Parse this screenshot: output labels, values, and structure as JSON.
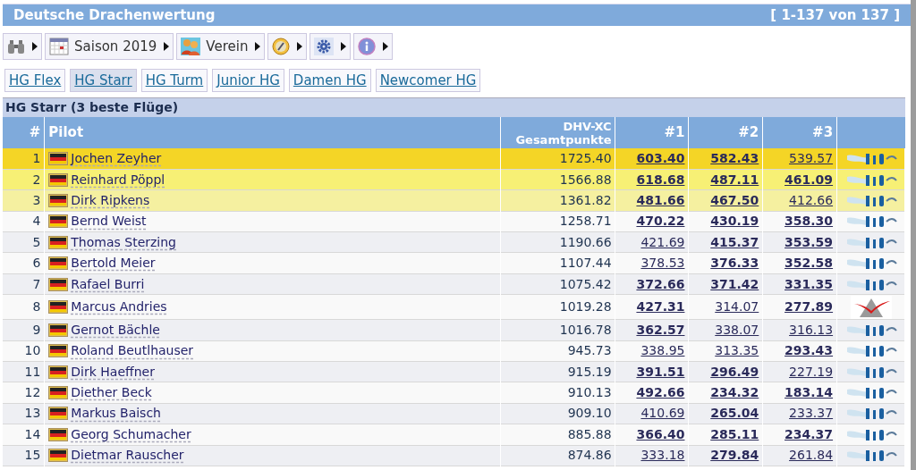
{
  "title": "Deutsche Drachenwertung",
  "range": "[ 1-137 von 137 ]",
  "toolbar": [
    {
      "kind": "binoculars"
    },
    {
      "kind": "calendar",
      "label": "Saison 2019"
    },
    {
      "kind": "people",
      "label": "Verein"
    },
    {
      "kind": "compass"
    },
    {
      "kind": "gear"
    },
    {
      "kind": "info"
    }
  ],
  "tabs": [
    {
      "label": "HG Flex",
      "selected": false
    },
    {
      "label": "HG Starr",
      "selected": true
    },
    {
      "label": "HG Turm",
      "selected": false
    },
    {
      "label": "Junior HG",
      "selected": false
    },
    {
      "label": "Damen HG",
      "selected": false
    },
    {
      "label": "Newcomer HG",
      "selected": false
    }
  ],
  "section_title": "HG Starr (3 beste Flüge)",
  "columns": [
    "#",
    "Pilot",
    "DHV-XC Gesamtpunkte",
    "#1",
    "#2",
    "#3"
  ],
  "rows": [
    {
      "rank": "1",
      "pilot": "Jochen Zeyher",
      "total": "1725.40",
      "flights": [
        {
          "score": "603.40",
          "bold": true
        },
        {
          "score": "582.43",
          "bold": true
        },
        {
          "score": "539.57",
          "bold": false
        }
      ],
      "logo": {
        "kind": "air"
      },
      "color": "#f4d526"
    },
    {
      "rank": "2",
      "pilot": "Reinhard Pöppl",
      "total": "1566.88",
      "flights": [
        {
          "score": "618.68",
          "bold": true
        },
        {
          "score": "487.11",
          "bold": true
        },
        {
          "score": "461.09",
          "bold": true
        }
      ],
      "logo": {
        "kind": "air"
      },
      "color": "#f7f075"
    },
    {
      "rank": "3",
      "pilot": "Dirk Ripkens",
      "total": "1361.82",
      "flights": [
        {
          "score": "481.66",
          "bold": true
        },
        {
          "score": "467.50",
          "bold": true
        },
        {
          "score": "412.66",
          "bold": false
        }
      ],
      "logo": {
        "kind": "air"
      },
      "color": "#f5f0a0"
    },
    {
      "rank": "4",
      "pilot": "Bernd Weist",
      "total": "1258.71",
      "flights": [
        {
          "score": "470.22",
          "bold": true
        },
        {
          "score": "430.19",
          "bold": true
        },
        {
          "score": "358.30",
          "bold": true
        }
      ],
      "logo": {
        "kind": "air"
      }
    },
    {
      "rank": "5",
      "pilot": "Thomas Sterzing",
      "total": "1190.66",
      "flights": [
        {
          "score": "421.69",
          "bold": false
        },
        {
          "score": "415.37",
          "bold": true
        },
        {
          "score": "353.59",
          "bold": true
        }
      ],
      "logo": {
        "kind": "air"
      }
    },
    {
      "rank": "6",
      "pilot": "Bertold Meier",
      "total": "1107.44",
      "flights": [
        {
          "score": "378.53",
          "bold": false
        },
        {
          "score": "376.33",
          "bold": true
        },
        {
          "score": "352.58",
          "bold": true
        }
      ],
      "logo": {
        "kind": "air"
      }
    },
    {
      "rank": "7",
      "pilot": "Rafael Burri",
      "total": "1075.42",
      "flights": [
        {
          "score": "372.66",
          "bold": true
        },
        {
          "score": "371.42",
          "bold": true
        },
        {
          "score": "331.35",
          "bold": true
        }
      ],
      "logo": {
        "kind": "air"
      }
    },
    {
      "rank": "8",
      "pilot": "Marcus Andries",
      "total": "1019.28",
      "flights": [
        {
          "score": "427.31",
          "bold": true
        },
        {
          "score": "314.07",
          "bold": false
        },
        {
          "score": "277.89",
          "bold": true
        }
      ],
      "logo": {
        "kind": "triangle"
      }
    },
    {
      "rank": "9",
      "pilot": "Gernot Bächle",
      "total": "1016.78",
      "flights": [
        {
          "score": "362.57",
          "bold": true
        },
        {
          "score": "338.07",
          "bold": false
        },
        {
          "score": "316.13",
          "bold": false
        }
      ],
      "logo": {
        "kind": "air"
      }
    },
    {
      "rank": "10",
      "pilot": "Roland Beutlhauser",
      "total": "945.73",
      "flights": [
        {
          "score": "338.95",
          "bold": false
        },
        {
          "score": "313.35",
          "bold": false
        },
        {
          "score": "293.43",
          "bold": true
        }
      ],
      "logo": {
        "kind": "air"
      }
    },
    {
      "rank": "11",
      "pilot": "Dirk Haeffner",
      "total": "915.19",
      "flights": [
        {
          "score": "391.51",
          "bold": true
        },
        {
          "score": "296.49",
          "bold": true
        },
        {
          "score": "227.19",
          "bold": false
        }
      ],
      "logo": {
        "kind": "air"
      }
    },
    {
      "rank": "12",
      "pilot": "Diether Beck",
      "total": "910.13",
      "flights": [
        {
          "score": "492.66",
          "bold": true
        },
        {
          "score": "234.32",
          "bold": true
        },
        {
          "score": "183.14",
          "bold": true
        }
      ],
      "logo": {
        "kind": "air"
      }
    },
    {
      "rank": "13",
      "pilot": "Markus Baisch",
      "total": "909.10",
      "flights": [
        {
          "score": "410.69",
          "bold": false
        },
        {
          "score": "265.04",
          "bold": true
        },
        {
          "score": "233.37",
          "bold": false
        }
      ],
      "logo": {
        "kind": "air"
      }
    },
    {
      "rank": "14",
      "pilot": "Georg Schumacher",
      "total": "885.88",
      "flights": [
        {
          "score": "366.40",
          "bold": true
        },
        {
          "score": "285.11",
          "bold": true
        },
        {
          "score": "234.37",
          "bold": true
        }
      ],
      "logo": {
        "kind": "air"
      }
    },
    {
      "rank": "15",
      "pilot": "Dietmar Rauscher",
      "total": "874.86",
      "flights": [
        {
          "score": "333.18",
          "bold": false
        },
        {
          "score": "279.84",
          "bold": true
        },
        {
          "score": "261.84",
          "bold": false
        }
      ],
      "logo": {
        "kind": "air"
      }
    }
  ]
}
